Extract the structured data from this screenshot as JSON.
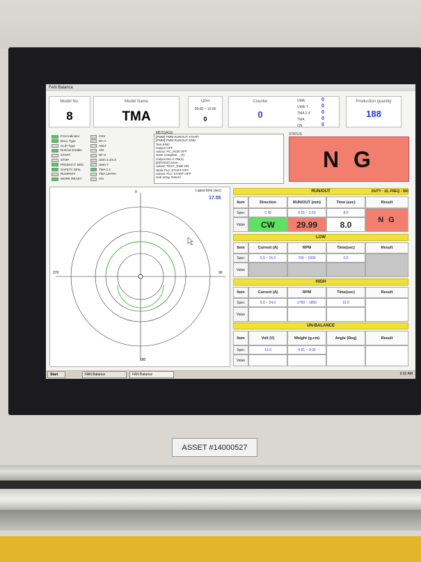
{
  "window": {
    "title": "FAN Balance"
  },
  "header": {
    "model_no": {
      "label": "Model No.",
      "value": "8"
    },
    "model_name": {
      "label": "Model Name",
      "value": "TMA"
    },
    "uph": {
      "label": "UPH",
      "time": "09:00 ~ 10:00",
      "value": "0"
    },
    "counter": {
      "label": "Counter",
      "value": "0"
    },
    "mini_counts": [
      {
        "label": "UMA",
        "value": "0"
      },
      {
        "label": "UMA-T",
        "value": "0"
      },
      {
        "label": "TMA 2.4",
        "value": "0"
      },
      {
        "label": "TMA",
        "value": "0"
      },
      {
        "label": "ON",
        "value": "0"
      }
    ],
    "production": {
      "label": "Production quantity",
      "value": "188"
    }
  },
  "indicators": [
    {
      "label": "FAN Indicator",
      "state": "on",
      "model": "CNV",
      "model_state": "off"
    },
    {
      "label": "BALL Type",
      "state": "on",
      "model": "NF-A",
      "model_state": "off"
    },
    {
      "label": "CLIP Type",
      "state": "off",
      "model": "ANLT",
      "model_state": "off"
    },
    {
      "label": "RunOut Enable",
      "state": "on",
      "model": "ANI",
      "model_state": "off"
    },
    {
      "label": "START",
      "state": "off",
      "model": "NF-3",
      "model_state": "off"
    },
    {
      "label": "STOP",
      "state": "off",
      "model": "UMA 2.4/3.3",
      "model_state": "off"
    },
    {
      "label": "PRODUCT SEN.",
      "state": "on",
      "model": "UMA-T",
      "model_state": "off"
    },
    {
      "label": "SAFETY SEN.",
      "state": "on",
      "model": "TMA 2.4",
      "model_state": "on"
    },
    {
      "label": "RUNPART",
      "state": "off",
      "model": "TMA 1M-RH",
      "model_state": "off"
    },
    {
      "label": "WORK READY",
      "state": "on",
      "model": "ON",
      "model_state": "off"
    }
  ],
  "message": {
    "label": "MESSAGE",
    "lines": [
      "[PMM] PMM RUNOUT START",
      "[PMM] PMM RUNOUT END",
      "Test END",
      "Output OFF",
      "outout: PC_RUN OFF",
      "Save complete... (4)",
      "Output NG-2 ON(4)",
      "[DEVICE] Save...",
      "outout: TEST_END ON",
      "Work PLC START-OFF",
      "outout: PLC START OFF",
      "Sub array, Return"
    ]
  },
  "status": {
    "label": "STATUS",
    "value": "N G",
    "color": "#f27e6e"
  },
  "polar": {
    "lapse_label": "Lapse time (sec)",
    "lapse_value": "17.55",
    "angle_0": "0",
    "angle_90": "90",
    "angle_180": "180",
    "angle_270": "270"
  },
  "runout": {
    "title": "RUN/OUT",
    "duty": "DUTY : 15, FREQ : 300",
    "headers": [
      "Item",
      "Direction",
      "RUN/OUT (mm)",
      "Time (sec)",
      "Result"
    ],
    "spec": [
      "Spec",
      "C W",
      "0.01 ~ 2.50",
      "8.0"
    ],
    "value": [
      "Value",
      "CW",
      "29.99",
      "8.0"
    ],
    "result": "N G"
  },
  "low": {
    "title": "LOW",
    "headers": [
      "Item",
      "Current (A)",
      "RPM",
      "Time(sec)",
      "Result"
    ],
    "spec": [
      "Spec",
      "5.0 ~ 15.0",
      "700 ~ 1000",
      "0.0"
    ],
    "value_label": "Value"
  },
  "high": {
    "title": "HIGH",
    "headers": [
      "Item",
      "Current (A)",
      "RPM",
      "Time(sec)",
      "Result"
    ],
    "spec": [
      "Spec",
      "5.0 ~ 24.0",
      "1750 ~ 1850",
      "15.0"
    ],
    "value_label": "Value"
  },
  "unbalance": {
    "title": "UN-BALANCE",
    "headers": [
      "Item",
      "Volt (V)",
      "Weight (g.cm)",
      "Angle (Deg)",
      "Result"
    ],
    "spec": [
      "Spec",
      "13.0",
      "0.01 ~ 3.00"
    ],
    "value_label": "Value"
  },
  "taskbar": {
    "start": "Start",
    "tasks": [
      "FAN Balance",
      "FAN Balance"
    ],
    "clock": "9:32 AM"
  },
  "asset_tag": "ASSET #14000527"
}
